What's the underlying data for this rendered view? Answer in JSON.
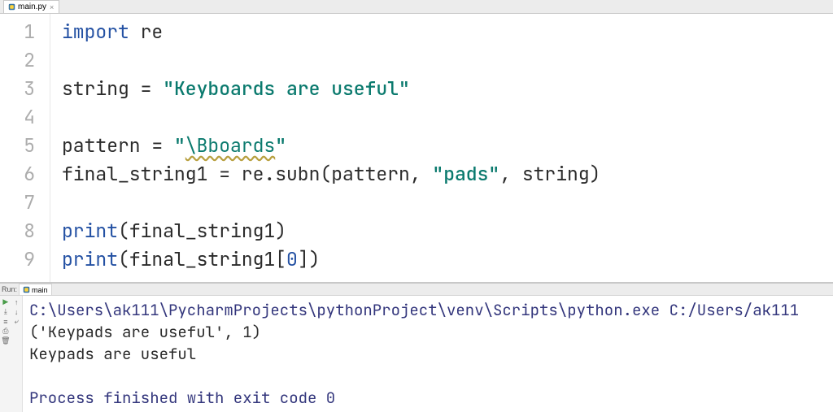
{
  "editor": {
    "tab": {
      "filename": "main.py"
    },
    "lines": {
      "import_kw": "import",
      "import_mod": " re",
      "l3_pre": "string = ",
      "l3_str": "\"Keyboards are useful\"",
      "l5_pre": "pattern = ",
      "l5_q1": "\"",
      "l5_esc": "\\Bboards",
      "l5_q2": "\"",
      "l6_pre": "final_string1 = re.subn(pattern, ",
      "l6_str": "\"pads\"",
      "l6_post": ", string)",
      "l8_fn": "print",
      "l8_args": "(final_string1)",
      "l9_fn": "print",
      "l9_a": "(final_string1[",
      "l9_num": "0",
      "l9_b": "])"
    },
    "line_numbers": [
      "1",
      "2",
      "3",
      "4",
      "5",
      "6",
      "7",
      "8",
      "9"
    ]
  },
  "run": {
    "label": "Run:",
    "config": "main",
    "output": {
      "path": "C:\\Users\\ak111\\PycharmProjects\\pythonProject\\venv\\Scripts\\python.exe C:/Users/ak111",
      "line2": "('Keypads are useful', 1)",
      "line3": "Keypads are useful",
      "blank": "",
      "exit": "Process finished with exit code 0"
    },
    "icons": {
      "play": "play-icon",
      "up": "up-icon",
      "stepdown": "down-arrow-icon",
      "gutter": "gutter-icon",
      "wrap": "wrap-icon",
      "print": "print-icon",
      "trash": "trash-icon"
    }
  }
}
